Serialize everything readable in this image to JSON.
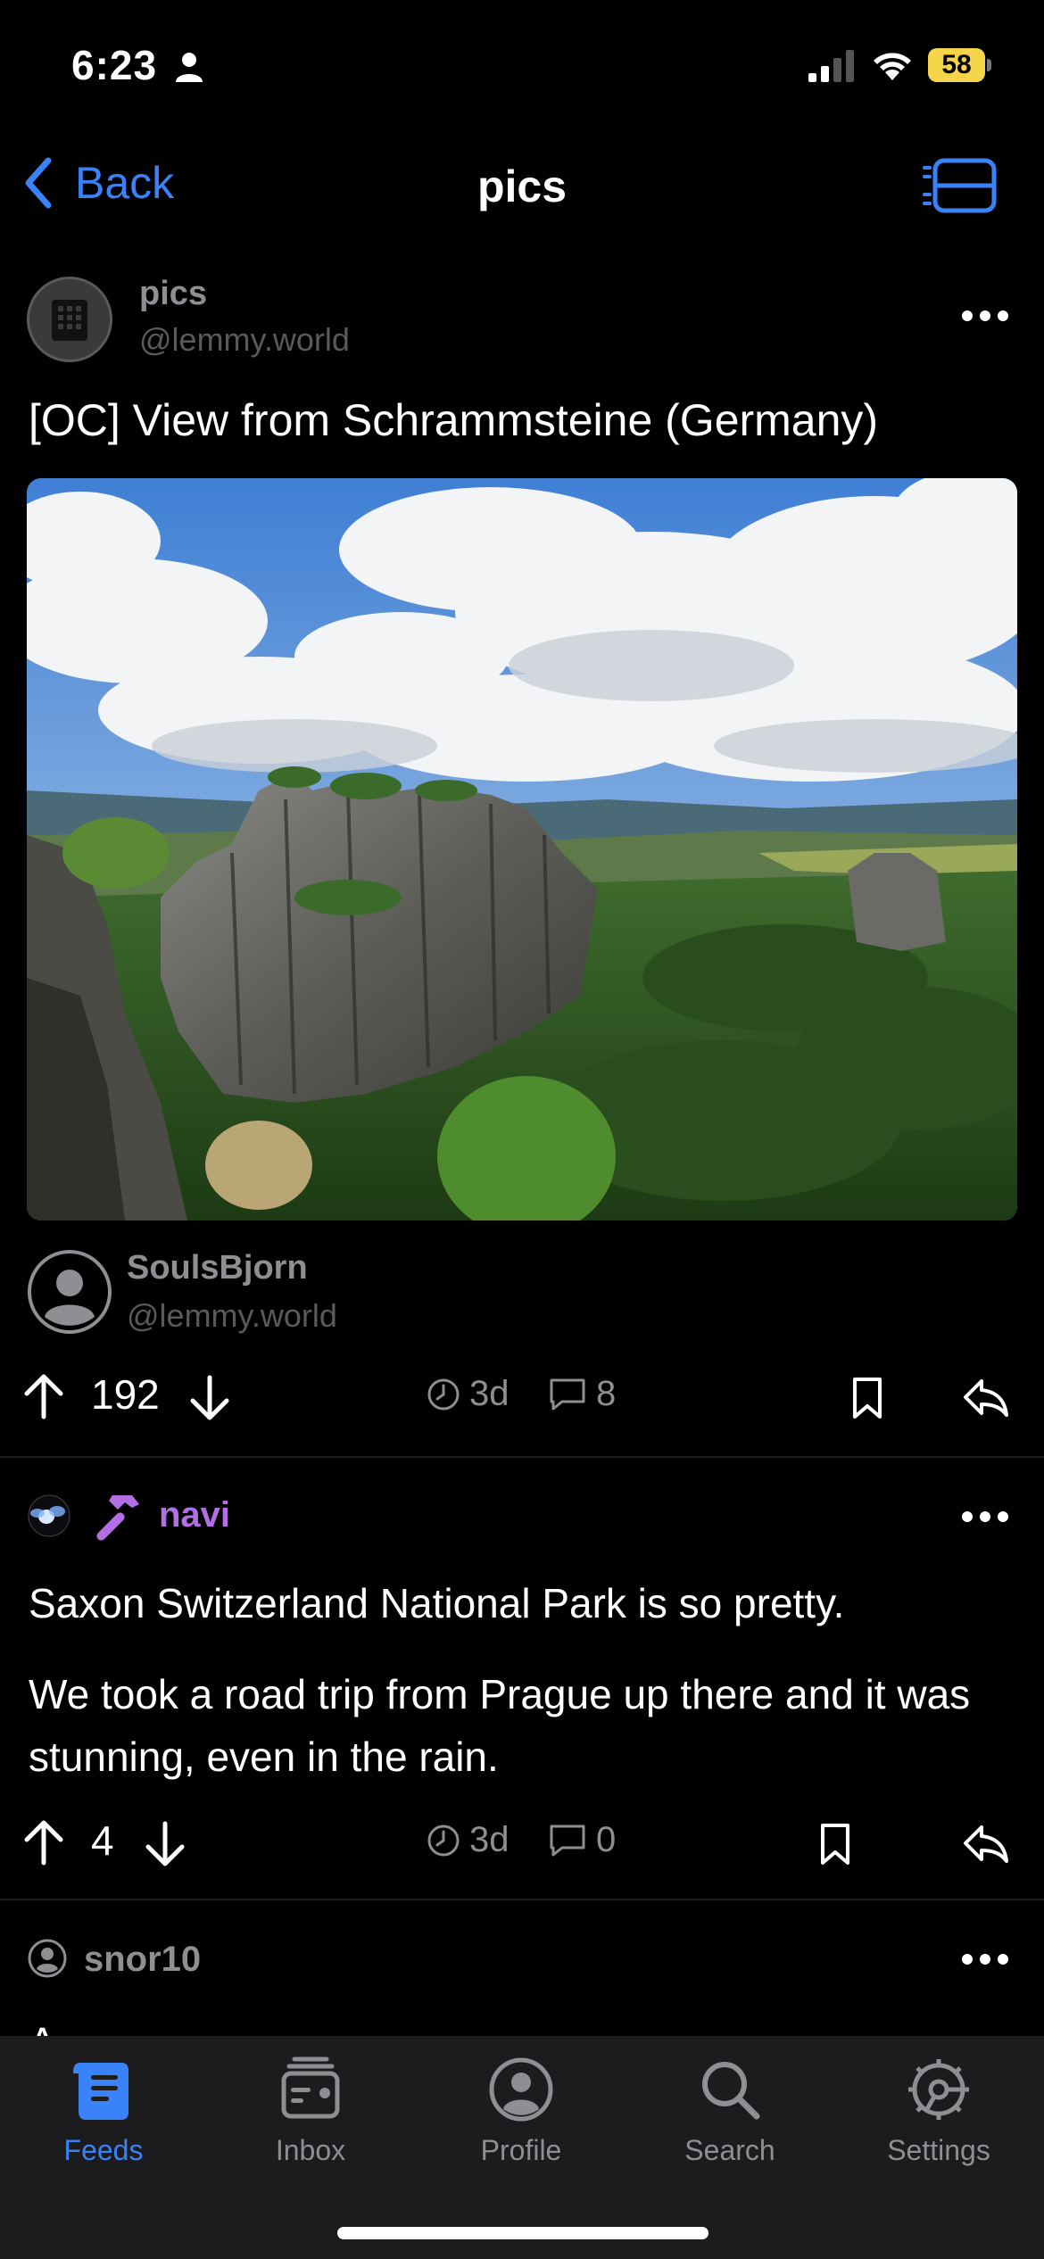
{
  "status_bar": {
    "time": "6:23",
    "battery": "58"
  },
  "nav": {
    "back_label": "Back",
    "title": "pics"
  },
  "post": {
    "community_name": "pics",
    "community_instance": "@lemmy.world",
    "title": "[OC] View from Schrammsteine (Germany)",
    "author_name": "SoulsBjorn",
    "author_instance": "@lemmy.world",
    "score": "192",
    "age": "3d",
    "comment_count": "8"
  },
  "comments": [
    {
      "author": "navi",
      "paragraphs": [
        "Saxon Switzerland National Park is so pretty.",
        "We took a road trip from Prague up there and it was stunning, even in the rain."
      ],
      "score": "4",
      "age": "3d",
      "reply_count": "0"
    },
    {
      "author": "snor10",
      "paragraphs": [
        "A"
      ]
    }
  ],
  "tabs": [
    {
      "label": "Feeds",
      "icon": "feeds-icon",
      "active": true
    },
    {
      "label": "Inbox",
      "icon": "inbox-icon",
      "active": false
    },
    {
      "label": "Profile",
      "icon": "profile-icon",
      "active": false
    },
    {
      "label": "Search",
      "icon": "search-icon",
      "active": false
    },
    {
      "label": "Settings",
      "icon": "settings-icon",
      "active": false
    }
  ],
  "colors": {
    "accent": "#3a82f7",
    "secondary_text": "#8e8e93",
    "comment_author": "#b36ee6",
    "battery": "#f6d54a"
  }
}
